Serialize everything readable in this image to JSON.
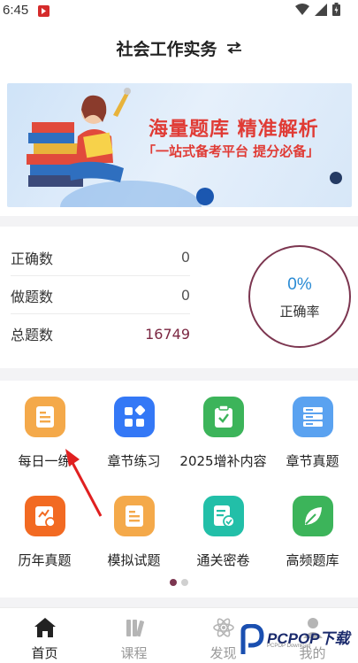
{
  "status_bar": {
    "time": "6:45"
  },
  "header": {
    "title": "社会工作实务"
  },
  "banner": {
    "headline": "海量题库 精准解析",
    "subline": "「一站式备考平台 提分必备」"
  },
  "stats": {
    "rows": [
      {
        "label": "正确数",
        "value": "0"
      },
      {
        "label": "做题数",
        "value": "0"
      },
      {
        "label": "总题数",
        "value": "16749"
      }
    ],
    "rate": {
      "value": "0%",
      "label": "正确率"
    }
  },
  "grid": {
    "items": [
      {
        "label": "每日一练",
        "icon": "daily-practice-icon",
        "color": "#f4a94a"
      },
      {
        "label": "章节练习",
        "icon": "chapter-practice-icon",
        "color": "#3478f6"
      },
      {
        "label": "2025增补内容",
        "icon": "supplement-icon",
        "color": "#3cb45a"
      },
      {
        "label": "章节真题",
        "icon": "chapter-exam-icon",
        "color": "#5aa2f0"
      },
      {
        "label": "历年真题",
        "icon": "past-exams-icon",
        "color": "#f26a22"
      },
      {
        "label": "模拟试题",
        "icon": "mock-test-icon",
        "color": "#f4a94a"
      },
      {
        "label": "通关密卷",
        "icon": "secret-paper-icon",
        "color": "#22bfa8"
      },
      {
        "label": "高频题库",
        "icon": "frequent-bank-icon",
        "color": "#3cb45a"
      }
    ],
    "pager": {
      "pages": 2,
      "active": 1
    }
  },
  "tabbar": {
    "tabs": [
      {
        "label": "首页",
        "icon": "home-icon",
        "active": true
      },
      {
        "label": "课程",
        "icon": "course-icon",
        "active": false
      },
      {
        "label": "发现",
        "icon": "discover-icon",
        "active": false
      },
      {
        "label": "我的",
        "icon": "profile-icon",
        "active": false
      }
    ]
  },
  "watermark": {
    "text": "PCPOP下载",
    "sub": "PCPOP Download"
  },
  "colors": {
    "accent": "#7c3650",
    "rate_text": "#2a8bd4",
    "banner_red": "#e03b35"
  }
}
